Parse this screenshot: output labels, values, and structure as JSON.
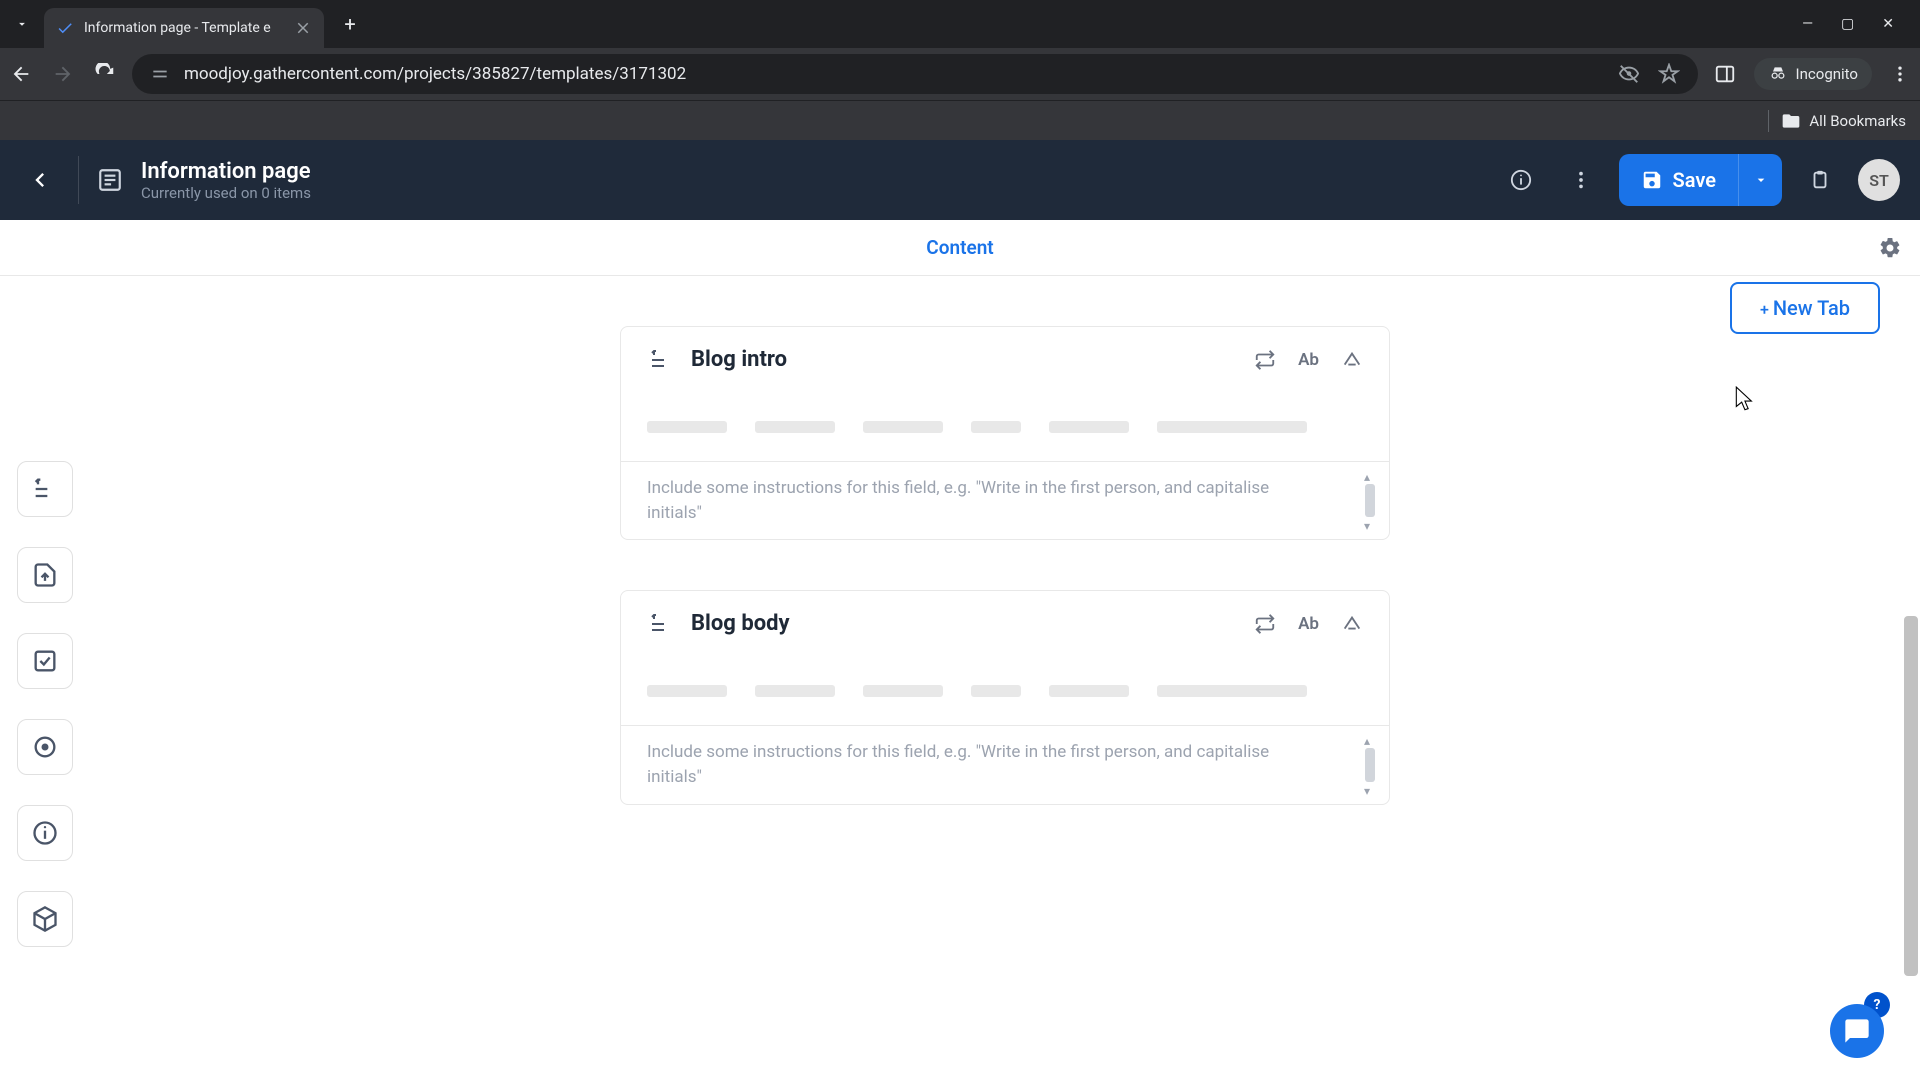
{
  "browser": {
    "tab_title": "Information page - Template e",
    "url": "moodjoy.gathercontent.com/projects/385827/templates/3171302",
    "incognito_label": "Incognito",
    "all_bookmarks_label": "All Bookmarks"
  },
  "header": {
    "title": "Information page",
    "subtitle": "Currently used on 0 items",
    "save_label": "Save",
    "avatar_initials": "ST"
  },
  "content_tab": {
    "label": "Content"
  },
  "new_tab_button": {
    "label": "New Tab"
  },
  "fields": [
    {
      "title": "Blog intro",
      "action_text": "Ab",
      "instructions_placeholder": "Include some instructions for this field, e.g. \"Write in the first person, and capitalise initials\""
    },
    {
      "title": "Blog body",
      "action_text": "Ab",
      "instructions_placeholder": "Include some instructions for this field, e.g. \"Write in the first person, and capitalise initials\""
    }
  ],
  "help": {
    "badge": "?"
  }
}
